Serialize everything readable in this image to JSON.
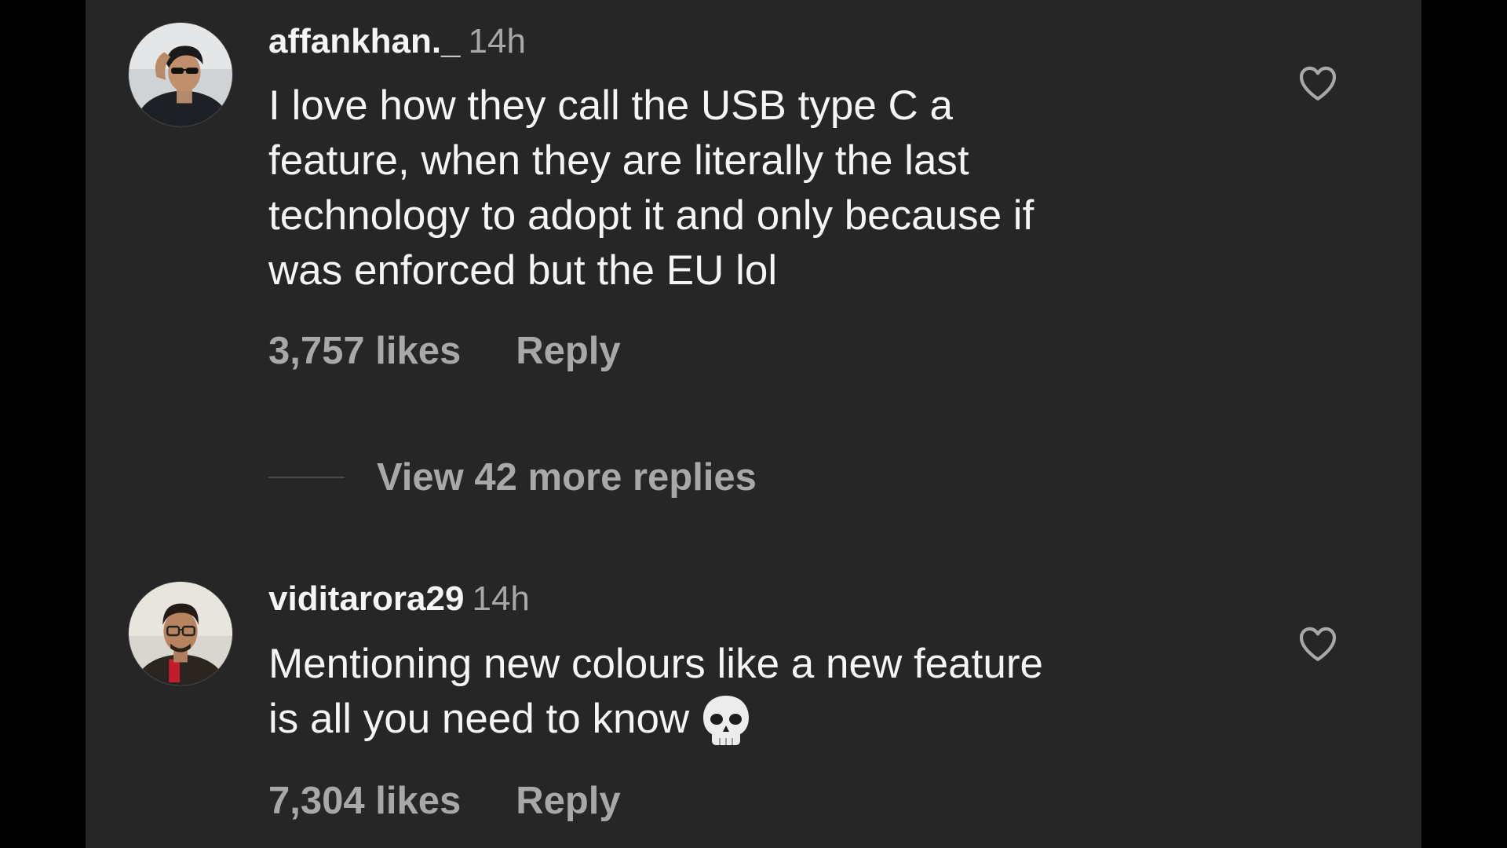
{
  "comments": [
    {
      "username": "affankhan._",
      "time": "14h",
      "text_lines": [
        "I love how they call the USB type C a",
        "feature, when they are literally the last",
        "technology to adopt it and only because if",
        "was enforced but the EU lol"
      ],
      "likes": "3,757 likes",
      "reply_label": "Reply",
      "avatar_icon": "profile-photo-man-sunglasses",
      "like_icon": "heart-outline-icon"
    },
    {
      "username": "viditarora29",
      "time": "14h",
      "text_lines": [
        "Mentioning new colours like a new feature",
        "is all you need to know"
      ],
      "emoji": "skull-emoji",
      "likes": "7,304 likes",
      "reply_label": "Reply",
      "avatar_icon": "profile-photo-man-glasses",
      "like_icon": "heart-outline-icon"
    }
  ],
  "view_replies": {
    "label": "View 42 more replies"
  },
  "colors": {
    "background": "#262626",
    "letterbox": "#000000",
    "primary_text": "#f5f5f5",
    "secondary_text": "#a8a8a8"
  }
}
